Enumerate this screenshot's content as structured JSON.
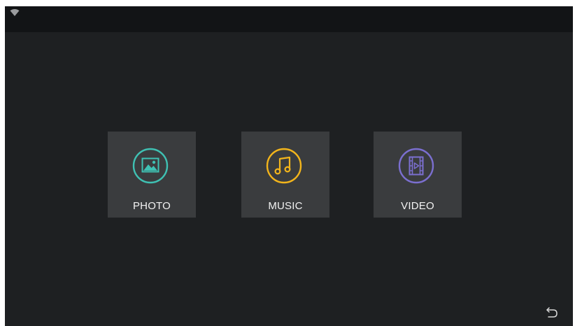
{
  "status_bar": {
    "wifi_icon": "wifi-icon"
  },
  "menu": {
    "items": [
      {
        "label": "PHOTO",
        "icon": "photo-icon",
        "color": "#3fc1b3"
      },
      {
        "label": "MUSIC",
        "icon": "music-note-icon",
        "color": "#f3b51b"
      },
      {
        "label": "VIDEO",
        "icon": "video-film-icon",
        "color": "#7b6fd0"
      }
    ]
  },
  "footer": {
    "back_icon": "back-arrow-icon"
  },
  "colors": {
    "background": "#1e2022",
    "status_bar": "#121416",
    "tile": "#3a3c3e"
  }
}
